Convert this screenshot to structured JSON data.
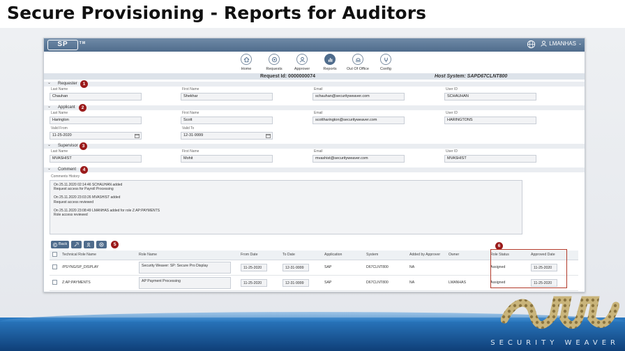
{
  "slide": {
    "title": "Secure Provisioning - Reports for Auditors",
    "brand": "SECURITY WEAVER"
  },
  "app": {
    "logo": "SP",
    "logo_tm": "TM",
    "user": "LMANHAS",
    "nav": [
      {
        "label": "Home",
        "icon": "home-icon"
      },
      {
        "label": "Requests",
        "icon": "requests-icon"
      },
      {
        "label": "Approver",
        "icon": "approver-icon"
      },
      {
        "label": "Reports",
        "icon": "reports-icon",
        "active": true
      },
      {
        "label": "Out Of Office",
        "icon": "out-of-office-icon"
      },
      {
        "label": "Config",
        "icon": "config-icon"
      }
    ],
    "request_id": "Request Id: 0000000074",
    "host_system": "Host System: SAPD67CLNT800"
  },
  "requester": {
    "title": "Requester",
    "badge": "1",
    "labels": {
      "last": "Last Name",
      "first": "First Name",
      "email": "Email",
      "uid": "User ID"
    },
    "last_name": "Chauhan",
    "first_name": "Shekhar",
    "email": "schauhan@securityweaver.com",
    "user_id": "SCHAUHAN"
  },
  "applicant": {
    "title": "Applicant",
    "badge": "2",
    "labels": {
      "last": "Last Name",
      "first": "First Name",
      "email": "Email",
      "uid": "User ID",
      "valid_from": "Valid From",
      "valid_to": "Valid To"
    },
    "last_name": "Harington",
    "first_name": "Scott",
    "email": "scottharington@securityweaver.com",
    "user_id": "HARINGTONS",
    "valid_from": "11-25-2020",
    "valid_to": "12-31-9999"
  },
  "supervisor": {
    "title": "Supervisor",
    "badge": "3",
    "labels": {
      "last": "Last Name",
      "first": "First Name",
      "email": "Email",
      "uid": "User ID"
    },
    "last_name": "MVASHIST",
    "first_name": "Mohit",
    "email": "mvashist@securityweaver.com",
    "user_id": "MVASHIST"
  },
  "comment": {
    "title": "Comment",
    "badge": "4",
    "history_label": "Comments History",
    "entries": [
      {
        "line1": "On 25.11.2020 02:14:46 SCHAUHAN added",
        "line2": "Request access for Payroll Processing"
      },
      {
        "line1": "On 25.11.2020 23:03:26 MVASHIST added",
        "line2": "Request access reviewed"
      },
      {
        "line1": "On 25.11.2020 23:08:49 LMANHAS added for role Z:AP:PAYMENTS",
        "line2": "Role access reviewed"
      }
    ]
  },
  "toolbar": {
    "back_label": "Back",
    "badge": "5"
  },
  "table": {
    "badge": "6",
    "headers": [
      "Technical Role Name",
      "Role Name",
      "From Date",
      "To Date",
      "Application",
      "System",
      "Added by Approver",
      "Owner",
      "Role Status",
      "Approved Date"
    ],
    "rows": [
      {
        "tech": "/PSYNG/SP_DISPLAY",
        "name": "Security Weaver: SP: Secure Pro Display",
        "from": "11-25-2020",
        "to": "12-31-9999",
        "app": "SAP",
        "system": "D67CLNT800",
        "added": "NA",
        "owner": "",
        "status": "Assigned",
        "approved": "11-25-2020"
      },
      {
        "tech": "Z:AP:PAYMENTS",
        "name": "AP Payment Processing",
        "from": "11-25-2020",
        "to": "12-31-9999",
        "app": "SAP",
        "system": "D67CLNT800",
        "added": "NA",
        "owner": "LMANHAS",
        "status": "Assigned",
        "approved": "11-25-2020"
      }
    ]
  },
  "colors": {
    "accent": "#4f6c8c",
    "badge": "#9b1b1b",
    "highlight": "#b23a2a",
    "wave": "#1f5c9c"
  }
}
